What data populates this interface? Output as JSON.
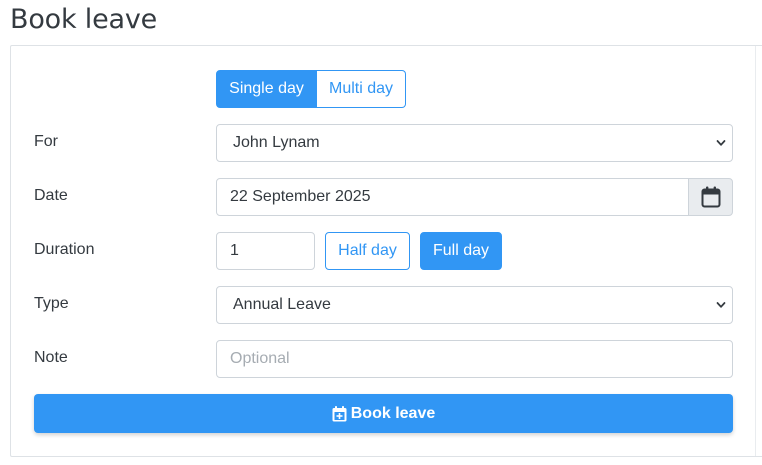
{
  "page": {
    "title": "Book leave"
  },
  "mode_toggle": {
    "single_label": "Single day",
    "multi_label": "Multi day",
    "selected": "Single day"
  },
  "form": {
    "for": {
      "label": "For",
      "value": "John Lynam"
    },
    "date": {
      "label": "Date",
      "value": "22 September 2025",
      "icon": "calendar-icon"
    },
    "duration": {
      "label": "Duration",
      "value": "1",
      "half_label": "Half day",
      "full_label": "Full day",
      "selected": "Full day"
    },
    "type": {
      "label": "Type",
      "value": "Annual Leave"
    },
    "note": {
      "label": "Note",
      "placeholder": "Optional",
      "value": ""
    }
  },
  "submit": {
    "label": "Book leave",
    "icon": "calendar-plus-icon"
  },
  "colors": {
    "accent": "#3196f4",
    "text": "#343a40",
    "border": "#ced4da",
    "addon_bg": "#e9ecef"
  }
}
